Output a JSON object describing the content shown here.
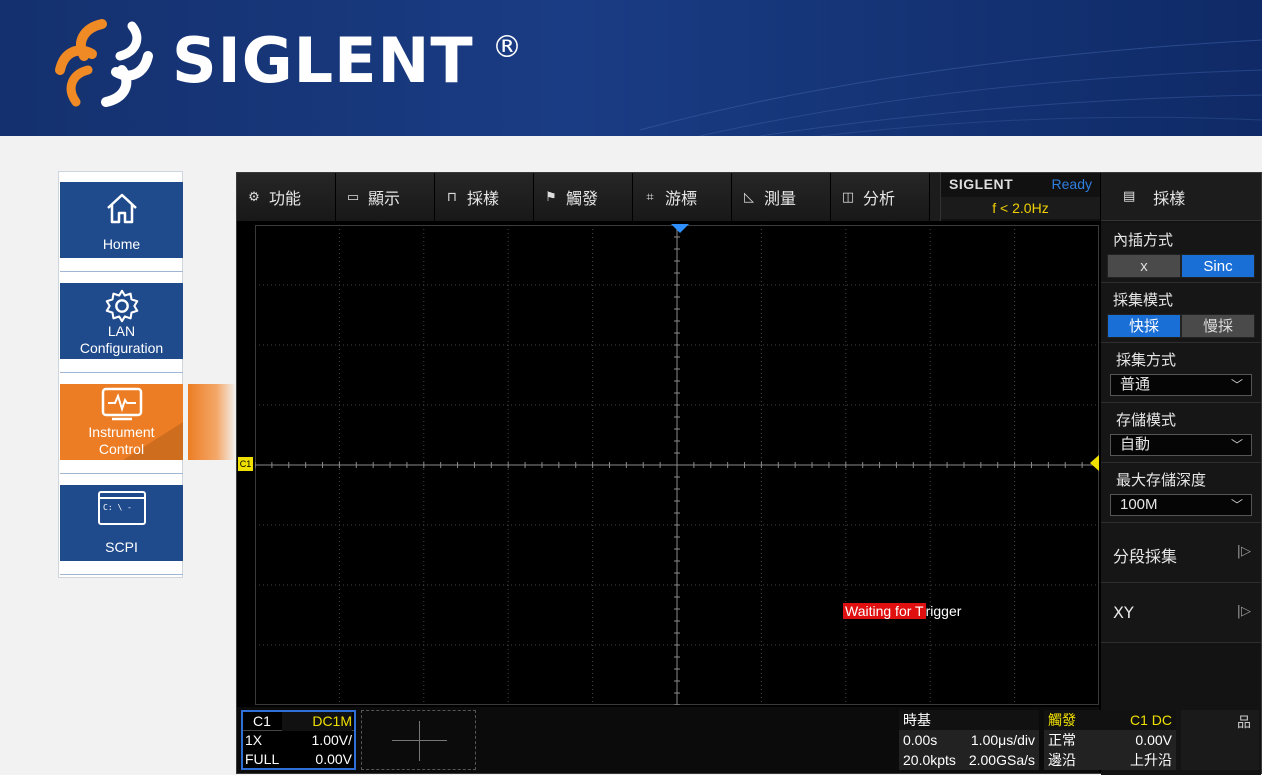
{
  "brand": {
    "name": "SIGLENT",
    "reg": "®"
  },
  "nav": {
    "items": [
      {
        "label": "Home",
        "icon": "home-icon"
      },
      {
        "label": "LAN Configuration",
        "icon": "gear-icon"
      },
      {
        "label": "Instrument Control",
        "icon": "monitor-pulse-icon",
        "active": true
      },
      {
        "label": "SCPI",
        "icon": "terminal-icon",
        "terminal_text": "C: \\ -"
      }
    ]
  },
  "scope": {
    "menu": [
      {
        "label": "功能",
        "icon": "gear-icon"
      },
      {
        "label": "顯示",
        "icon": "display-icon"
      },
      {
        "label": "採樣",
        "icon": "acquire-icon"
      },
      {
        "label": "觸發",
        "icon": "flag-icon"
      },
      {
        "label": "游標",
        "icon": "cursor-icon"
      },
      {
        "label": "測量",
        "icon": "measure-icon"
      },
      {
        "label": "分析",
        "icon": "analysis-icon"
      }
    ],
    "status": {
      "brand": "SIGLENT",
      "state": "Ready",
      "frequency": "f < 2.0Hz"
    },
    "right_panel": {
      "title": "採樣",
      "interpolation": {
        "title": "內插方式",
        "options": [
          "x",
          "Sinc"
        ],
        "selected": "Sinc"
      },
      "acq_mode": {
        "title": "採集模式",
        "options": [
          "快採",
          "慢採"
        ],
        "selected": "快採"
      },
      "acq_type": {
        "title": "採集方式",
        "value": "普通"
      },
      "mem_mode": {
        "title": "存儲模式",
        "value": "自動"
      },
      "max_depth": {
        "title": "最大存儲深度",
        "value": "100M"
      },
      "segmented": {
        "label": "分段採集"
      },
      "xy": {
        "label": "XY"
      }
    },
    "waiting": {
      "highlight": "Waiting for T",
      "rest": "rigger"
    },
    "channel_marker": "C1",
    "channel": {
      "name": "C1",
      "coupling": "DC1M",
      "probe": "1X",
      "scale": "1.00V/",
      "bandwidth": "FULL",
      "offset": "0.00V"
    },
    "timebase": {
      "title": "時基",
      "delay": "0.00s",
      "scale": "1.00μs/div",
      "points": "20.0kpts",
      "rate": "2.00GSa/s"
    },
    "trigger": {
      "title": "觸發",
      "source": "C1 DC",
      "mode": "正常",
      "level": "0.00V",
      "type": "邊沿",
      "slope": "上升沿"
    },
    "network_icon": "network-icon"
  },
  "colors": {
    "nav_blue": "#1f4a8c",
    "nav_active": "#ec7d24",
    "trigger_yellow": "#f0e000",
    "selected_blue": "#1a6fd6",
    "ready_blue": "#2f7fdf"
  }
}
